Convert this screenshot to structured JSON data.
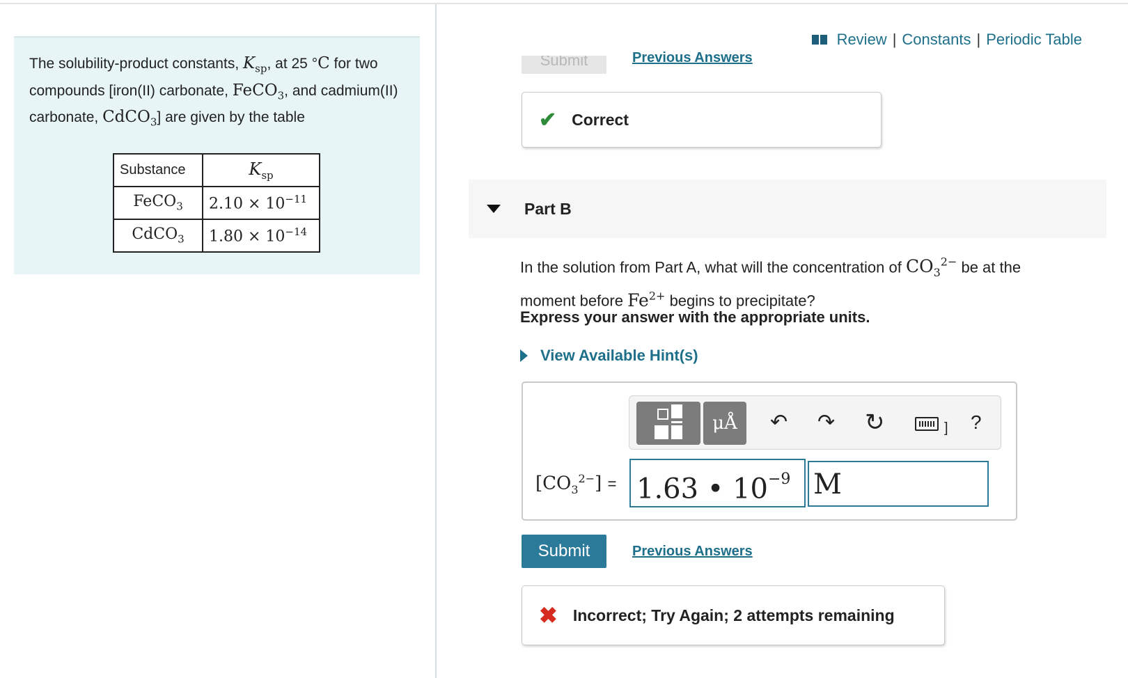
{
  "header": {
    "links": [
      "Review",
      "Constants",
      "Periodic Table"
    ],
    "separator": "|"
  },
  "problem": {
    "intro_1": "The solubility-product constants, ",
    "ksp_symbol": "K",
    "ksp_sub": "sp",
    "intro_2": ", at 25 °",
    "celsius": "C",
    "intro_3": " for two compounds [iron(II) carbonate, ",
    "feco3": "FeCO",
    "feco3_sub": "3",
    "intro_4": ", and cadmium(II) carbonate, ",
    "cdco3": "CdCO",
    "cdco3_sub": "3",
    "intro_5": "] are given by the table",
    "table": {
      "header_substance": "Substance",
      "header_ksp": "K",
      "header_ksp_sub": "sp",
      "rows": [
        {
          "substance": "FeCO",
          "sub": "3",
          "mantissa": "2.10 × 10",
          "exp": "−11"
        },
        {
          "substance": "CdCO",
          "sub": "3",
          "mantissa": "1.80 × 10",
          "exp": "−14"
        }
      ]
    }
  },
  "part_a": {
    "submit_label": "Submit",
    "previous_answers_label": "Previous Answers",
    "feedback": "Correct"
  },
  "part_b": {
    "label": "Part B",
    "question_1": "In the solution from Part A, what will the concentration of ",
    "co3": "CO",
    "co3_sub": "3",
    "co3_sup": "2−",
    "question_2": " be at the moment before ",
    "fe": "Fe",
    "fe_sup": "2+",
    "question_3": " begins to precipitate?",
    "instruction": "Express your answer with the appropriate units.",
    "hint_label": "View Available Hint(s)",
    "toolbar": {
      "units_label": "μÅ",
      "icons": [
        "templates-icon",
        "units-icon",
        "undo-icon",
        "redo-icon",
        "reset-icon",
        "keyboard-icon",
        "help-icon"
      ],
      "help_label": "?"
    },
    "answer": {
      "lhs_open": "[CO",
      "lhs_sub": "3",
      "lhs_sup": "2−",
      "lhs_close": "]",
      "equals": "=",
      "value": "1.63 • 10",
      "exponent": "−9",
      "unit": "M"
    },
    "submit_label": "Submit",
    "previous_answers_label": "Previous Answers",
    "feedback": "Incorrect; Try Again; 2 attempts remaining"
  },
  "colors": {
    "accent": "#1d6f8a",
    "submit_bg": "#2b7a99",
    "correct": "#2f8a3a",
    "incorrect": "#d62b1f",
    "left_panel_bg": "#e8f5f6"
  }
}
